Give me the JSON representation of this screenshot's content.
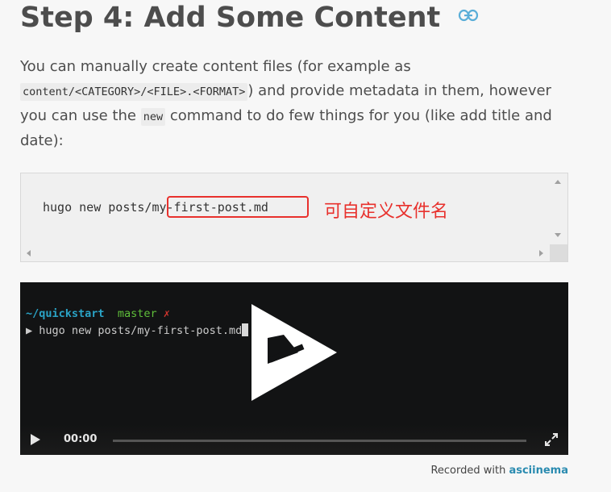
{
  "heading": "Step 4: Add Some Content",
  "paragraph": {
    "part1": "You can manually create content files (for example as ",
    "code1": "content/<CATEGORY>/<FILE>.<FORMAT>",
    "part2": ") and provide metadata in them, however you can use the ",
    "code2": "new",
    "part3": " command to do few things for you (like add title and date):"
  },
  "code_block": {
    "command": "hugo new posts/my-first-post.md",
    "annotation": "可自定义文件名"
  },
  "terminal": {
    "path": "~/quickstart",
    "branch": "master",
    "dirty_mark": "✗",
    "prompt": "▶",
    "command": "hugo new posts/my-first-post.md"
  },
  "player": {
    "time": "00:00",
    "progress": 0
  },
  "footer": {
    "recorded_prefix": "Recorded with ",
    "recorded_link": "asciinema"
  },
  "colors": {
    "annotation": "#e8312d",
    "path": "#2aa3c6",
    "branch": "#5fbf3a",
    "link": "#2a8bb0"
  },
  "icons": [
    "link-icon",
    "asciinema-logo-icon",
    "play-icon",
    "fullscreen-icon"
  ]
}
